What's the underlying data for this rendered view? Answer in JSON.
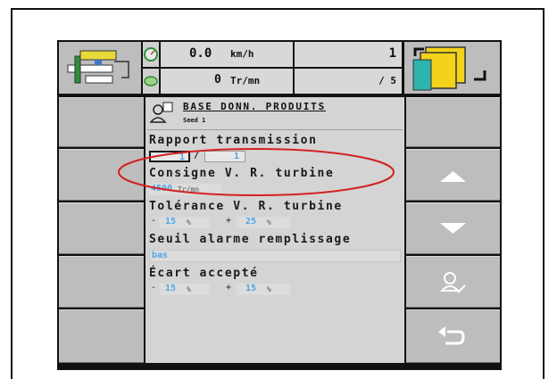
{
  "status": {
    "speed_value": "0.0",
    "speed_unit": "km/h",
    "rpm_value": "0",
    "rpm_unit": "Tr/mn",
    "page_current": "1",
    "page_total": "/ 5"
  },
  "header": {
    "title": "BASE DONN. PRODUITS",
    "subtitle": "Seed 1"
  },
  "fields": {
    "rapport": {
      "label": "Rapport transmission",
      "value1": "1",
      "separator": "/",
      "value2": "1"
    },
    "consigne": {
      "label": "Consigne V. R. turbine",
      "value": "4500",
      "unit": "Tr/mn"
    },
    "tolerance": {
      "label": "Tolérance V. R. turbine",
      "minus_sign": "-",
      "value1": "15",
      "unit1": "%",
      "plus_sign": "+",
      "value2": "25",
      "unit2": "%"
    },
    "seuil": {
      "label": "Seuil alarme remplissage",
      "value": "bas"
    },
    "ecart": {
      "label": "Écart accepté",
      "minus_sign": "-",
      "value1": "15",
      "unit1": "%",
      "plus_sign": "+",
      "value2": "15",
      "unit2": "%"
    }
  },
  "colors": {
    "highlight_ellipse": "#d42020",
    "value_blue": "#4ea6e6",
    "panel_gray": "#d4d4d4",
    "button_gray": "#bdbdbd"
  },
  "icons": [
    "tractor-seeder-icon",
    "speedometer-icon",
    "turbine-icon",
    "machine-yellow-icon",
    "arrow-up-icon",
    "arrow-down-icon",
    "user-edit-icon",
    "return-icon",
    "product-user-icon"
  ]
}
